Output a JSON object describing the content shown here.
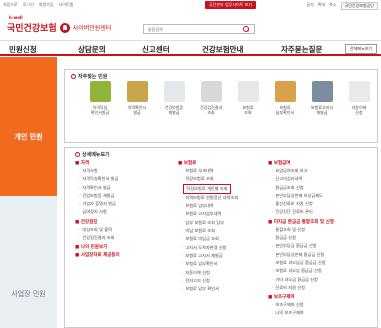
{
  "topbar": {
    "links": [
      "처음으로",
      "로그인",
      "회원가입",
      "사이트맵"
    ],
    "center_banner": "공단본부 업무사이트 보기",
    "right_links": [
      "글자",
      "확대",
      "축소"
    ],
    "lang_select": "국민건강보험공단"
  },
  "header": {
    "hwell": "h-well",
    "logo_name": "국민건강보험",
    "logo_sub": "사이버민원센터",
    "search_placeholder": "통합검색"
  },
  "nav": {
    "items": [
      "민원신청",
      "상담문의",
      "신고센터",
      "건강보험안내",
      "자주묻는질문"
    ],
    "allmenu": "전체메뉴보기"
  },
  "sidebar": {
    "personal": "개인 민원",
    "business": "사업장 민원"
  },
  "quick": {
    "title": "자주찾는 민원",
    "items": [
      {
        "label": "자격득실\n확인서발급",
        "color": "#8fb43a"
      },
      {
        "label": "자격확인서\n발급",
        "color": "#caa64a"
      },
      {
        "label": "건강보험증\n재발급",
        "color": "#e4e8ec"
      },
      {
        "label": "건강검진결과\n조회",
        "color": "#d8d8d8"
      },
      {
        "label": "보험료\n조회",
        "color": "#e7e7e7"
      },
      {
        "label": "보험료\n납부확인서",
        "color": "#d9a24a"
      },
      {
        "label": "보험료고지서\n재발급",
        "color": "#7a8ea0"
      },
      {
        "label": "자동이체\n신청",
        "color": "#e9e9e9"
      }
    ]
  },
  "detail": {
    "title": "상세메뉴보기",
    "col1": [
      {
        "group": "자격",
        "links": [
          "자격사항",
          "자격득실확인서 발급",
          "자격확인서 발급",
          "건강보험증 재발급",
          "가입자 증명서 발급",
          "급여정지 사항"
        ]
      },
      {
        "group": "건강검진",
        "links": [
          "대상조회 및 출력",
          "건강검진결과 조회"
        ]
      },
      {
        "group": "나의 민원보기",
        "links": []
      },
      {
        "group": "사업장자료 제공동의",
        "links": []
      }
    ],
    "col2": [
      {
        "group": "보험료",
        "links": [
          "보험료 부과내역",
          "직장보험료 조회",
          "직장보험료 개인별 조회",
          "지역보험료 연말정산 내역조회"
        ],
        "highlight_index": 2
      },
      {
        "group": "",
        "links": [
          "보험료 납부내역",
          "보험료 고지납부내역",
          "납부 보험료 조회 납부",
          "미납 보험료 조회",
          "보험료 미납금 조회",
          "고지서 도착자변경 신청",
          "보험료 고지서 재발급",
          "보험료 납부확인서",
          "자동이체 신청",
          "전자고지 신청",
          "보험료 납부 확인서"
        ],
        "highlight_index": -1
      }
    ],
    "col3": [
      {
        "group": "보험급여",
        "links": [
          "요양급여조회 보고",
          "신고의심리내역",
          "환급금조회 신청",
          "본인부담상한제 보상금제도",
          "출산진료비 지원 신청",
          "건강진단 진료비 관리"
        ]
      },
      {
        "group": "미지급 환급금 통합조회 및 신청",
        "links": [
          "통합조회 및 신청",
          "환급금 신청",
          "본인부담금 환급금 신청",
          "본인부담상한제 환급금 신청",
          "보험료 과오납금 환급금 신청",
          "보험료 과오납 환급금 신청",
          "기타 과오급 환급금 신청",
          "진료비 지원 신청"
        ]
      },
      {
        "group": "보조구제여",
        "links": [
          "보조구제여 신청",
          "나의 보조구제여"
        ]
      }
    ]
  }
}
